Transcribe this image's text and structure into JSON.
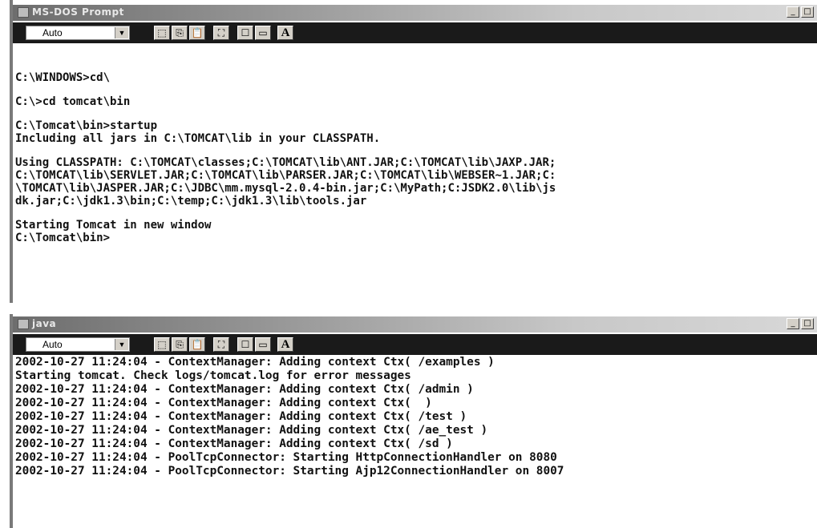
{
  "window1": {
    "title": "MS-DOS Prompt",
    "font_select": "Auto",
    "lines": [
      "C:\\WINDOWS>cd\\",
      "",
      "C:\\>cd tomcat\\bin",
      "",
      "C:\\Tomcat\\bin>startup",
      "Including all jars in C:\\TOMCAT\\lib in your CLASSPATH.",
      "",
      "Using CLASSPATH: C:\\TOMCAT\\classes;C:\\TOMCAT\\lib\\ANT.JAR;C:\\TOMCAT\\lib\\JAXP.JAR;",
      "C:\\TOMCAT\\lib\\SERVLET.JAR;C:\\TOMCAT\\lib\\PARSER.JAR;C:\\TOMCAT\\lib\\WEBSER~1.JAR;C:",
      "\\TOMCAT\\lib\\JASPER.JAR;C:\\JDBC\\mm.mysql-2.0.4-bin.jar;C:\\MyPath;C:JSDK2.0\\lib\\js",
      "dk.jar;C:\\jdk1.3\\bin;C:\\temp;C:\\jdk1.3\\lib\\tools.jar",
      "",
      "Starting Tomcat in new window",
      "C:\\Tomcat\\bin>"
    ]
  },
  "window2": {
    "title": "java",
    "font_select": "Auto",
    "lines": [
      "2002-10-27 11:24:04 - ContextManager: Adding context Ctx( /examples )",
      "Starting tomcat. Check logs/tomcat.log for error messages",
      "2002-10-27 11:24:04 - ContextManager: Adding context Ctx( /admin )",
      "2002-10-27 11:24:04 - ContextManager: Adding context Ctx(  )",
      "2002-10-27 11:24:04 - ContextManager: Adding context Ctx( /test )",
      "2002-10-27 11:24:04 - ContextManager: Adding context Ctx( /ae_test )",
      "2002-10-27 11:24:04 - ContextManager: Adding context Ctx( /sd )",
      "2002-10-27 11:24:04 - PoolTcpConnector: Starting HttpConnectionHandler on 8080",
      "2002-10-27 11:24:04 - PoolTcpConnector: Starting Ajp12ConnectionHandler on 8007"
    ]
  },
  "toolbar_icons": [
    "mark-icon",
    "copy-icon",
    "paste-icon",
    "fullscreen-icon",
    "properties-icon",
    "background-icon",
    "font-icon"
  ],
  "font_button_label": "A",
  "window_buttons": {
    "minimize": "_",
    "maximize": "□"
  }
}
